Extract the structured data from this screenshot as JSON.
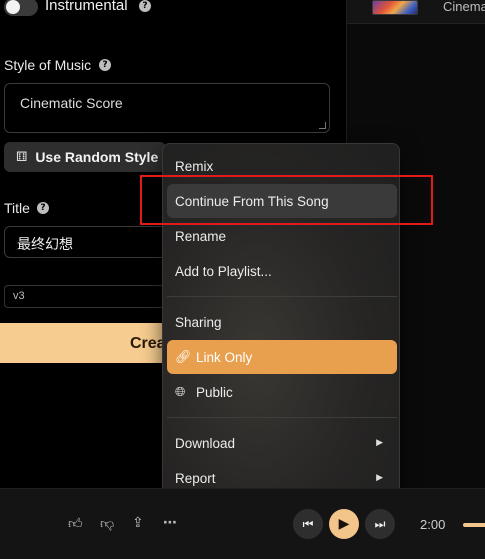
{
  "instrumental": {
    "label": "Instrumental",
    "help": "?"
  },
  "style": {
    "label": "Style of Music",
    "help": "?",
    "value": "Cinematic Score",
    "random_button": "Use Random Style"
  },
  "title": {
    "label": "Title",
    "help": "?",
    "value": "最终幻想"
  },
  "model": {
    "value": "v3"
  },
  "create_button": "Crea",
  "now_playing": {
    "song_name": "Cinema"
  },
  "menu": {
    "items": [
      {
        "label": "Remix"
      },
      {
        "label": "Continue From This Song"
      },
      {
        "label": "Rename"
      },
      {
        "label": "Add to Playlist..."
      },
      {
        "label": "Sharing"
      },
      {
        "label": "Link Only",
        "icon": "link-icon"
      },
      {
        "label": "Public",
        "icon": "globe-icon"
      },
      {
        "label": "Download",
        "icon": "chevron-right-icon"
      },
      {
        "label": "Report",
        "icon": "chevron-right-icon"
      }
    ]
  },
  "player": {
    "time": "2:00"
  },
  "colors": {
    "accent": "#e9a04e",
    "play": "#f4c58a",
    "highlight": "#e11b1b"
  }
}
